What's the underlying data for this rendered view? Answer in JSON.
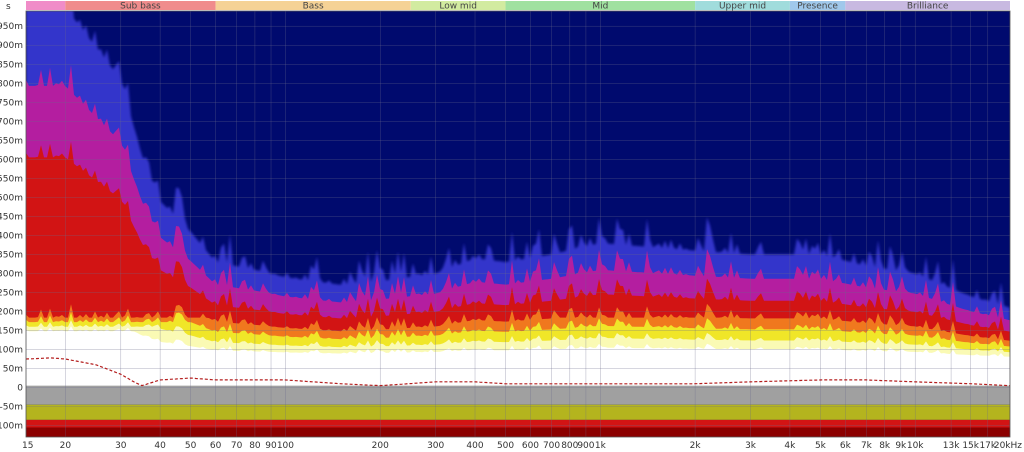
{
  "chart_data": {
    "type": "heatmap",
    "title": "",
    "xlabel": "",
    "ylabel": "s",
    "xscale": "log",
    "xlim": [
      15,
      20000
    ],
    "ylim": [
      -0.13,
      0.99
    ],
    "grid": true,
    "x_ticks": [
      {
        "value": 15,
        "label": "15"
      },
      {
        "value": 20,
        "label": "20"
      },
      {
        "value": 30,
        "label": "30"
      },
      {
        "value": 40,
        "label": "40"
      },
      {
        "value": 50,
        "label": "50"
      },
      {
        "value": 60,
        "label": "60"
      },
      {
        "value": 70,
        "label": "70"
      },
      {
        "value": 80,
        "label": "80"
      },
      {
        "value": 90,
        "label": "90"
      },
      {
        "value": 100,
        "label": "100"
      },
      {
        "value": 200,
        "label": "200"
      },
      {
        "value": 300,
        "label": "300"
      },
      {
        "value": 400,
        "label": "400"
      },
      {
        "value": 500,
        "label": "500"
      },
      {
        "value": 600,
        "label": "600"
      },
      {
        "value": 700,
        "label": "700"
      },
      {
        "value": 800,
        "label": "800"
      },
      {
        "value": 900,
        "label": "900"
      },
      {
        "value": 1000,
        "label": "1k"
      },
      {
        "value": 2000,
        "label": "2k"
      },
      {
        "value": 3000,
        "label": "3k"
      },
      {
        "value": 4000,
        "label": "4k"
      },
      {
        "value": 5000,
        "label": "5k"
      },
      {
        "value": 6000,
        "label": "6k"
      },
      {
        "value": 7000,
        "label": "7k"
      },
      {
        "value": 8000,
        "label": "8k"
      },
      {
        "value": 9000,
        "label": "9k"
      },
      {
        "value": 10000,
        "label": "10k"
      },
      {
        "value": 13000,
        "label": "13k"
      },
      {
        "value": 15000,
        "label": "15k"
      },
      {
        "value": 17000,
        "label": "17k"
      },
      {
        "value": 20000,
        "label": "20kHz"
      }
    ],
    "y_ticks": [
      {
        "value": 0.95,
        "label": "950m"
      },
      {
        "value": 0.9,
        "label": "900m"
      },
      {
        "value": 0.85,
        "label": "850m"
      },
      {
        "value": 0.8,
        "label": "800m"
      },
      {
        "value": 0.75,
        "label": "750m"
      },
      {
        "value": 0.7,
        "label": "700m"
      },
      {
        "value": 0.65,
        "label": "650m"
      },
      {
        "value": 0.6,
        "label": "600m"
      },
      {
        "value": 0.55,
        "label": "550m"
      },
      {
        "value": 0.5,
        "label": "500m"
      },
      {
        "value": 0.45,
        "label": "450m"
      },
      {
        "value": 0.4,
        "label": "400m"
      },
      {
        "value": 0.35,
        "label": "350m"
      },
      {
        "value": 0.3,
        "label": "300m"
      },
      {
        "value": 0.25,
        "label": "250m"
      },
      {
        "value": 0.2,
        "label": "200m"
      },
      {
        "value": 0.15,
        "label": "150m"
      },
      {
        "value": 0.1,
        "label": "100m"
      },
      {
        "value": 0.05,
        "label": "50m"
      },
      {
        "value": 0,
        "label": "0"
      },
      {
        "value": -0.05,
        "label": "-50m"
      },
      {
        "value": -0.1,
        "label": "-100m"
      }
    ],
    "bands": [
      {
        "label": "",
        "from": 15,
        "to": 20,
        "color": "#f08cc8"
      },
      {
        "label": "Sub bass",
        "from": 20,
        "to": 60,
        "color": "#f08c8c"
      },
      {
        "label": "Bass",
        "from": 60,
        "to": 250,
        "color": "#f5d296"
      },
      {
        "label": "Low mid",
        "from": 250,
        "to": 500,
        "color": "#d2eba0"
      },
      {
        "label": "Mid",
        "from": 500,
        "to": 2000,
        "color": "#a0e1a0"
      },
      {
        "label": "Upper mid",
        "from": 2000,
        "to": 4000,
        "color": "#a0dcdc"
      },
      {
        "label": "Presence",
        "from": 4000,
        "to": 6000,
        "color": "#a0c8eb"
      },
      {
        "label": "Brilliance",
        "from": 6000,
        "to": 20000,
        "color": "#c8b9e1"
      }
    ],
    "colors": {
      "background": "#000a6e",
      "blue": "#3c3cdc",
      "purple": "#b41ea0",
      "red": "#d21414",
      "orange": "#f0781e",
      "yellow": "#f0e628",
      "pale_yellow": "#fafab4",
      "white": "#ffffff",
      "gray": "#a0a0a0",
      "olive": "#b4b41e",
      "dark_red": "#8c0000",
      "decay_line": "#b41e1e"
    },
    "decay_time": {
      "x": [
        15,
        18,
        20,
        25,
        30,
        33,
        35,
        40,
        50,
        60,
        80,
        100,
        150,
        200,
        300,
        400,
        500,
        700,
        1000,
        2000,
        3000,
        5000,
        7000,
        10000,
        15000,
        20000
      ],
      "y": [
        0.075,
        0.078,
        0.075,
        0.06,
        0.035,
        0.015,
        0.005,
        0.02,
        0.025,
        0.02,
        0.02,
        0.02,
        0.01,
        0.005,
        0.015,
        0.015,
        0.01,
        0.01,
        0.01,
        0.01,
        0.015,
        0.02,
        0.02,
        0.015,
        0.01,
        0.005
      ]
    },
    "ringing_envelope": {
      "x": [
        15,
        20,
        30,
        35,
        40,
        50,
        60,
        80,
        100,
        150,
        200,
        300,
        400,
        500,
        700,
        1000,
        2000,
        3000,
        5000,
        7000,
        10000,
        15000,
        20000
      ],
      "y": [
        0.99,
        0.99,
        0.8,
        0.6,
        0.48,
        0.4,
        0.32,
        0.3,
        0.28,
        0.26,
        0.27,
        0.29,
        0.33,
        0.32,
        0.34,
        0.37,
        0.35,
        0.34,
        0.34,
        0.31,
        0.29,
        0.23,
        0.2
      ]
    }
  }
}
